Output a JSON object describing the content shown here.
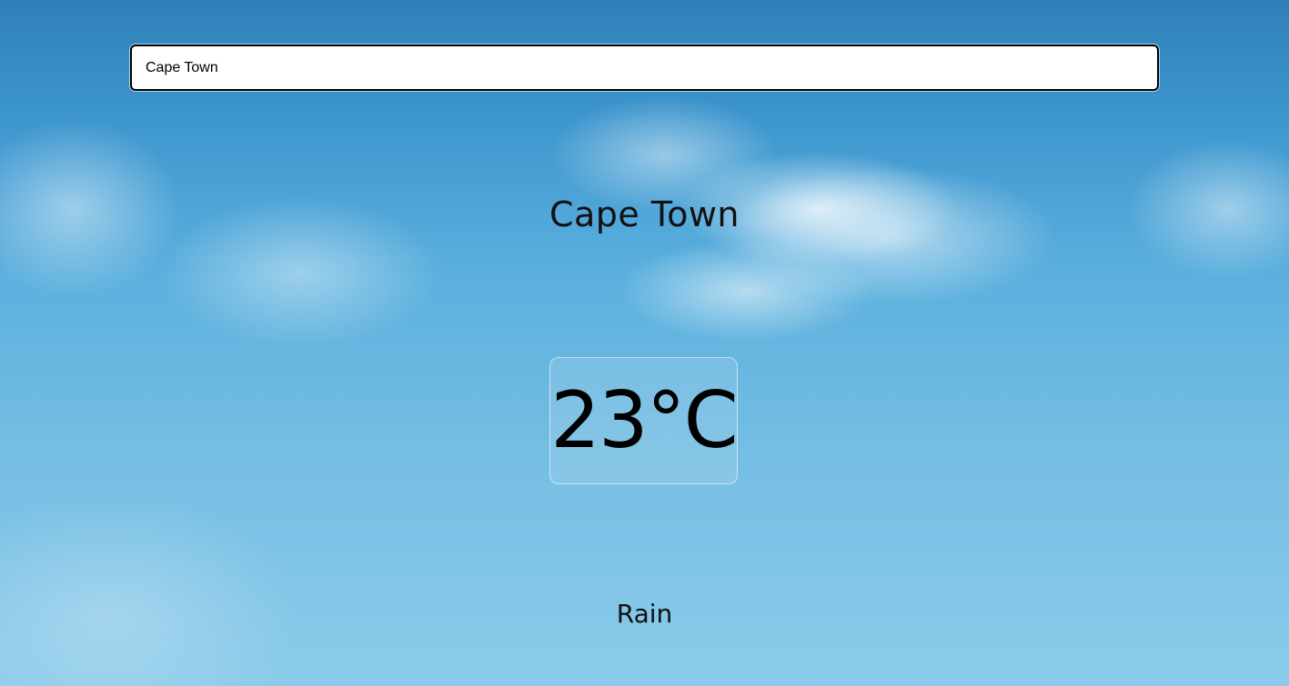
{
  "search": {
    "value": "Cape Town"
  },
  "weather": {
    "city": "Cape Town",
    "temperature": "23°C",
    "condition": "Rain"
  },
  "colors": {
    "sky_top": "#2f80b8",
    "sky_bottom": "#8ccbea",
    "text": "#111111"
  }
}
